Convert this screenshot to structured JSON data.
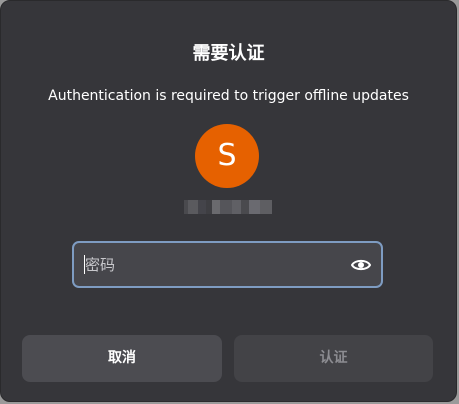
{
  "dialog": {
    "title": "需要认证",
    "message": "Authentication is required to trigger offline updates",
    "avatar_initial": "S",
    "username": "",
    "password": {
      "placeholder": "密码",
      "value": ""
    },
    "buttons": {
      "cancel_label": "取消",
      "authenticate_label": "认证"
    },
    "icons": {
      "reveal": "eye-icon"
    },
    "colors": {
      "avatar": "#e66100",
      "focus_border": "#7e9cc2",
      "background": "#36363a"
    }
  }
}
